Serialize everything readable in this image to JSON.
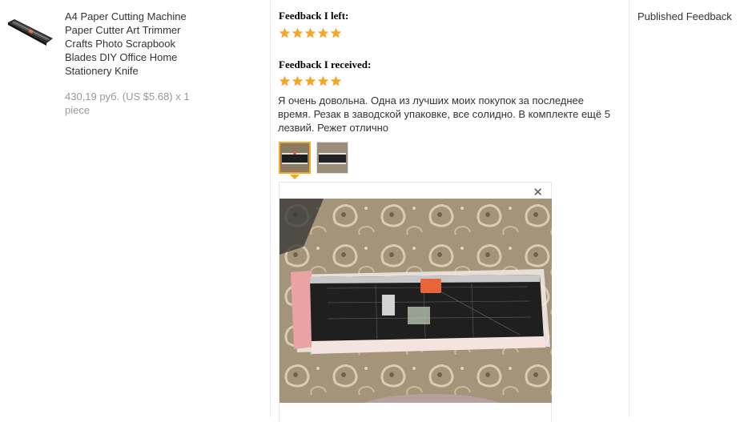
{
  "product": {
    "title": "A4 Paper Cutting Machine Paper Cutter Art Trimmer Crafts Photo Scrapbook Blades DIY Office Home Stationery Knife",
    "price": "430,19 руб. (US $5.68) x 1 piece"
  },
  "feedback_left": {
    "heading": "Feedback I left:",
    "stars": 5
  },
  "feedback_received": {
    "heading": "Feedback I received:",
    "stars": 5,
    "text": "Я очень довольна. Одна из лучших моих покупок за последнее время. Резак в заводской упаковке, все солидно. В комплекте ещё 5 лезвий. Режет отлично"
  },
  "photos": {
    "active_index": 0,
    "count": 2,
    "close_icon": "close-icon"
  },
  "status": {
    "label": "Published Feedback"
  },
  "colors": {
    "star": "#f5a623",
    "active_border": "#f5a623",
    "muted_text": "#999999"
  }
}
